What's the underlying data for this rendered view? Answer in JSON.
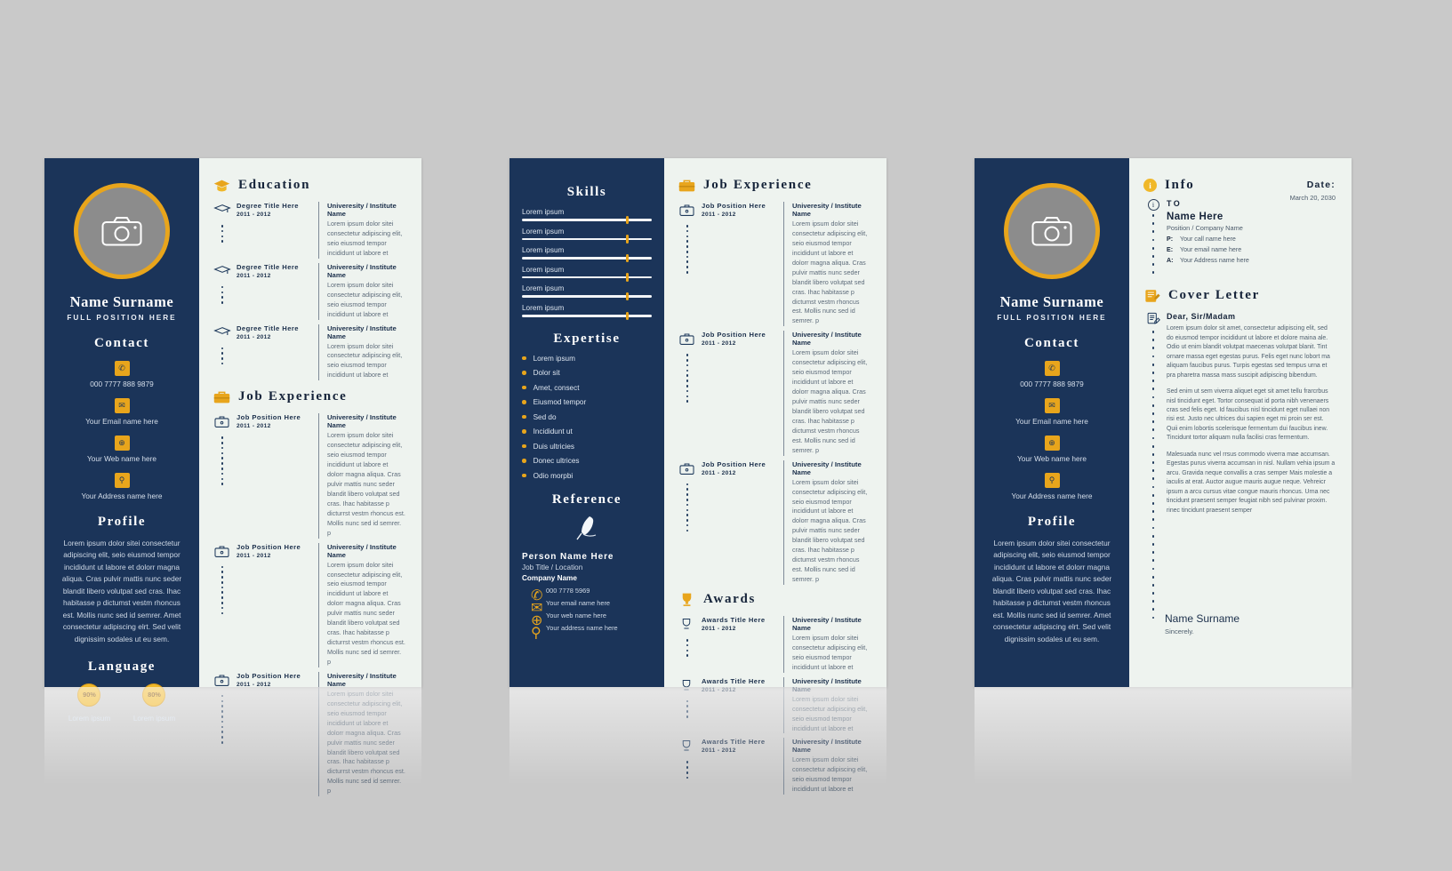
{
  "theme": {
    "navy": "#1b3459",
    "gold": "#e8a51c",
    "paper": "#eef3ef",
    "photo_gray": "#8c8c8c"
  },
  "person": {
    "name": "Name Surname",
    "position": "FULL POSITION HERE",
    "phone": "000 7777 888 9879",
    "email": "Your Email name here",
    "web": "Your Web name here",
    "address": "Your Address name here"
  },
  "sections": {
    "contact": "Contact",
    "profile": "Profile",
    "language": "Language",
    "education": "Education",
    "job_experience": "Job Experience",
    "skills": "Skills",
    "expertise": "Expertise",
    "reference": "Reference",
    "awards": "Awards",
    "info": "Info",
    "cover_letter": "Cover Letter"
  },
  "profile_text": "Lorem ipsum dolor sitei consectetur adipiscing elit, seio eiusmod tempor incididunt ut labore et dolorr magna aliqua. Cras pulvir mattis nunc seder blandit libero volutpat sed cras. Ihac habitasse p dictumst vestm rhoncus est. Mollis nunc sed id semrer. Amet consectetur adipiscing elrt. Sed velit dignissim sodales ut eu sem.",
  "languages": [
    {
      "percent": "90%",
      "label": "Lorem ipsum"
    },
    {
      "percent": "80%",
      "label": "Lorem ipsum"
    }
  ],
  "education": [
    {
      "title": "Degree Title Here",
      "dates": "2011 - 2012",
      "org": "Univeresity / Institute Name",
      "desc": "Lorem ipsum dolor sitei consectetur adipiscing elit, seio eiusmod tempor incididunt ut labore et",
      "dots": 4
    },
    {
      "title": "Degree Title Here",
      "dates": "2011 - 2012",
      "org": "Univeresity / Institute Name",
      "desc": "Lorem ipsum dolor sitei consectetur adipiscing elit, seio eiusmod tempor incididunt ut labore et",
      "dots": 4
    },
    {
      "title": "Degree Title Here",
      "dates": "2011 - 2012",
      "org": "Univeresity / Institute Name",
      "desc": "Lorem ipsum dolor sitei consectetur adipiscing elit, seio eiusmod tempor incididunt ut labore et",
      "dots": 4
    }
  ],
  "jobs_p1": [
    {
      "title": "Job Position Here",
      "dates": "2011 - 2012",
      "org": "Univeresity / Institute Name",
      "desc": "Lorem ipsum dolor sitei consectetur adipiscing elit, seio eiusmod tempor incididunt ut labore et dolorr magna aliqua. Cras pulvir mattis nunc seder blandit libero volutpat sed cras. Ihac habitasse p dicturrst vestm rhoncus est. Mollis nunc sed id semrer. p",
      "dots": 10
    },
    {
      "title": "Job Position Here",
      "dates": "2011 - 2012",
      "org": "Univeresity / Institute Name",
      "desc": "Lorem ipsum dolor sitei consectetur adipiscing elit, seio eiusmod tempor incididunt ut labore et dolorr magna aliqua. Cras pulvir mattis nunc seder blandit libero volutpat sed cras. Ihac habitasse p dicturrst vestm rhoncus est. Mollis nunc sed id semrer. p",
      "dots": 10
    },
    {
      "title": "Job Position Here",
      "dates": "2011 - 2012",
      "org": "Univeresity / Institute Name",
      "desc": "Lorem ipsum dolor sitei consectetur adipiscing elit, seio eiusmod tempor incididunt ut labore et dolorr magna aliqua. Cras pulvir mattis nunc seder blandit libero volutpat sed cras. Ihac habitasse p dicturrst vestm rhoncus est. Mollis nunc sed id semrer. p",
      "dots": 10
    }
  ],
  "jobs_p2": [
    {
      "title": "Job Position Here",
      "dates": "2011 - 2012",
      "org": "Univeresity / Institute Name",
      "desc": "Lorem ipsum dolor sitei consectetur adipiscing elit, seio eiusmod tempor incididunt ut labore et dolorr magna aliqua. Cras pulvir mattis nunc seder blandit libero volutpat sed cras. Ihac habitasse p dictumst vestm rhoncus est. Mollis nunc sed id semrer. p",
      "dots": 10
    },
    {
      "title": "Job Position Here",
      "dates": "2011 - 2012",
      "org": "Univeresity / Institute Name",
      "desc": "Lorem ipsum dolor sitei consectetur adipiscing elit, seio eiusmod tempor incididunt ut labore et dolorr magna aliqua. Cras pulvir mattis nunc seder blandit libero volutpat sed cras. Ihac habitasse p dictumst vestm rhoncus est. Mollis nunc sed id semrer. p",
      "dots": 10
    },
    {
      "title": "Job Position Here",
      "dates": "2011 - 2012",
      "org": "Univeresity / Institute Name",
      "desc": "Lorem ipsum dolor sitei consectetur adipiscing elit, seio eiusmod tempor incididunt ut labore et dolorr magna aliqua. Cras pulvir mattis nunc seder blandit libero volutpat sed cras. Ihac habitasse p dictumst vestm rhoncus est. Mollis nunc sed id semrer. p",
      "dots": 10
    }
  ],
  "awards": [
    {
      "title": "Awards Title Here",
      "dates": "2011 - 2012",
      "org": "Univeresity / Institute Name",
      "desc": "Lorem ipsum dolor sitei consectetur adipiscing elit, seio eiusmod tempor incididunt ut labore et",
      "dots": 4
    },
    {
      "title": "Awards Title Here",
      "dates": "2011 - 2012",
      "org": "Univeresity / Institute Name",
      "desc": "Lorem ipsum dolor sitei consectetur adipiscing elit, seio eiusmod tempor incididunt ut labore et",
      "dots": 4
    },
    {
      "title": "Awards Title Here",
      "dates": "2011 - 2012",
      "org": "Univeresity / Institute Name",
      "desc": "Lorem ipsum dolor sitei consectetur adipiscing elit, seio eiusmod tempor incididunt ut labore et",
      "dots": 4
    }
  ],
  "skills": [
    {
      "label": "Lorem ipsum",
      "value": 80
    },
    {
      "label": "Lorem ipsum",
      "value": 80
    },
    {
      "label": "Lorem ipsum",
      "value": 80
    },
    {
      "label": "Lorem ipsum",
      "value": 80
    },
    {
      "label": "Lorem ipsum",
      "value": 80
    },
    {
      "label": "Lorem ipsum",
      "value": 80
    }
  ],
  "expertise": [
    "Lorem ipsum",
    "Dolor sit",
    "Amet, consect",
    "Eiusmod tempor",
    "Sed do",
    "Incididunt ut",
    "Duis ultricies",
    "Donec ultrices",
    "Odio morpbi"
  ],
  "reference": {
    "name": "Person Name Here",
    "job_title": "Job Title / Location",
    "company": "Company Name",
    "phone": "000 7778 5969",
    "email": "Your email name here",
    "web": "Your web name here",
    "address": "Your address name here"
  },
  "info": {
    "to_label": "TO",
    "name": "Name Here",
    "position": "Position / Company Name",
    "rows": [
      {
        "key": "P:",
        "value": "Your  call name here"
      },
      {
        "key": "E:",
        "value": "Your  email name here"
      },
      {
        "key": "A:",
        "value": "Your  Address name here"
      }
    ],
    "date_label": "Date:",
    "date_value": "March 20, 2030"
  },
  "cover_letter": {
    "salutation": "Dear, Sir/Madam",
    "paragraphs": [
      "Lorem ipsum dolor sit amet, consectetur adipiscing elit, sed do eiusmod tempor incididunt ut labore et dolore maina ale. Odio ut enim blandit volutpat maecenas volutpat blanit. Tint ornare massa eget egestas purus. Felis eget nunc lobort ma aliquam faucibus purus. Turpis egestas sed tempus urna et pra pharetra massa mass suscipit adipiscing bibendum.",
      "Sed enim ut sem viverra aliquet eget sit amet tellu frarcrbus nisl tincidunt eget. Tortor consequat id porta nibh venenaers cras sed felis eget. Id faucibus nisl tincidunt eget nullaei non risi est. Justo nec ultrices dui sapien eget mi proin ser est. Quii enim lobortis scelerisque fermentum dui faucibus inew. Tincidunt tortor aliquam nulla facilisi cras fermentum.",
      "Malesuada nunc vel rrsus commodo viverra mae accumsan. Egestas purus viverra accumsan in nisl. Nullam vehia ipsum a arcu. Gravida neque convallis a cras semper Mais molestie a iaculis at erat. Auctor augue mauris augue neque. Vehreicr ipsum a arcu cursus vitae congue mauris rhoncus. Urna nec tincidunt praesent semper feugiat nibh sed pulvinar proxim. rinec tincidunt praesent semper"
    ],
    "signature_name": "Name Surname",
    "signature_sub": "Sincerely."
  },
  "icons": {
    "camera": "camera-icon",
    "phone": "phone-icon",
    "email": "email-icon",
    "web": "globe-icon",
    "address": "location-pin-icon",
    "graduation": "graduation-cap-icon",
    "briefcase": "briefcase-icon",
    "trophy": "trophy-icon",
    "feather": "feather-pen-icon",
    "info": "info-icon",
    "note": "note-pencil-icon"
  }
}
